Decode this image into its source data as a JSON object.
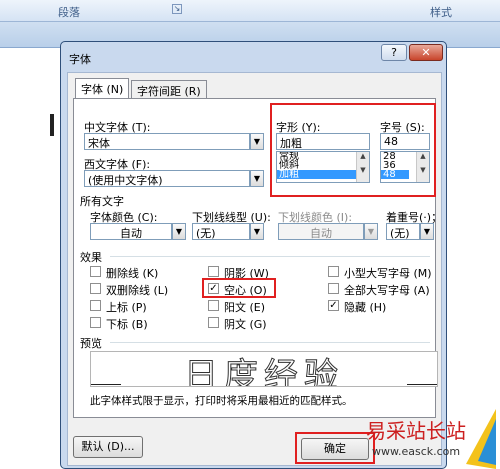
{
  "ribbon": {
    "group_paragraph": "段落",
    "group_styles": "样式"
  },
  "dialog": {
    "title": "字体",
    "help": "?",
    "close": "✕",
    "tabs": [
      {
        "label": "字体 (N)"
      },
      {
        "label": "字符间距 (R)"
      }
    ],
    "chinese_font": {
      "label": "中文字体 (T):",
      "value": "宋体"
    },
    "western_font": {
      "label": "西文字体 (F):",
      "value": "(使用中文字体)"
    },
    "style": {
      "label": "字形 (Y):",
      "value": "加粗",
      "options": [
        "常规",
        "倾斜",
        "加粗"
      ],
      "selected": "加粗"
    },
    "size": {
      "label": "字号 (S):",
      "value": "48",
      "options": [
        "28",
        "36",
        "48"
      ],
      "selected": "48"
    },
    "all_text": {
      "heading": "所有文字",
      "font_color": {
        "label": "字体颜色 (C):",
        "value": "自动"
      },
      "underline_type": {
        "label": "下划线线型 (U):",
        "value": "(无)"
      },
      "underline_color": {
        "label": "下划线颜色 (I):",
        "value": "自动"
      },
      "emphasis": {
        "label": "着重号(·)；",
        "value": "(无)"
      }
    },
    "effects": {
      "heading": "效果",
      "items": [
        {
          "label": "删除线 (K)",
          "checked": false
        },
        {
          "label": "双删除线 (L)",
          "checked": false
        },
        {
          "label": "上标 (P)",
          "checked": false
        },
        {
          "label": "下标 (B)",
          "checked": false
        },
        {
          "label": "阴影 (W)",
          "checked": false
        },
        {
          "label": "空心 (O)",
          "checked": true
        },
        {
          "label": "阳文 (E)",
          "checked": false
        },
        {
          "label": "阴文 (G)",
          "checked": false
        },
        {
          "label": "小型大写字母 (M)",
          "checked": false
        },
        {
          "label": "全部大写字母 (A)",
          "checked": false
        },
        {
          "label": "隐藏 (H)",
          "checked": true
        }
      ]
    },
    "preview": {
      "heading": "预览",
      "sample": "日度经验",
      "note": "此字体样式限于显示，打印时将采用最相近的匹配样式。"
    },
    "buttons": {
      "default": "默认 (D)...",
      "ok": "确定"
    }
  },
  "watermark": {
    "text": "易采站长站",
    "url": "www.easck.com"
  },
  "colors": {
    "highlight_red": "#e02020",
    "selection_blue": "#3399ff",
    "dialog_frame": "#c9d9ee"
  }
}
